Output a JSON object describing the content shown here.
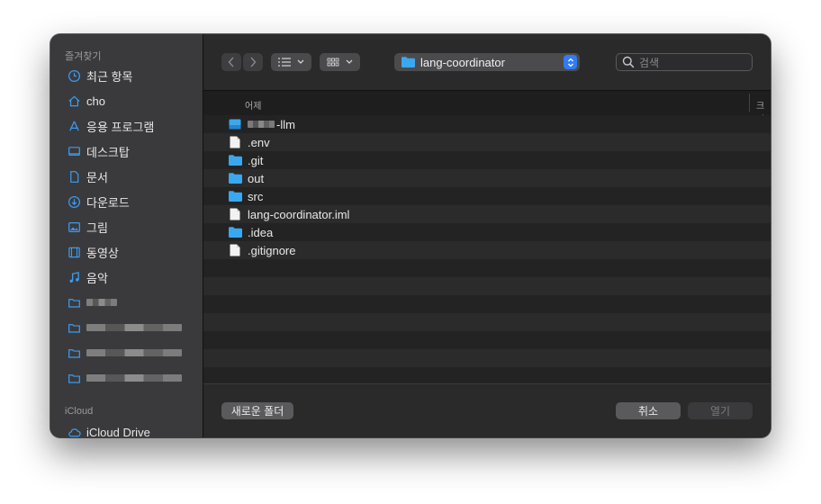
{
  "sidebar": {
    "favorites_title": "즐겨찾기",
    "items": [
      {
        "label": "최근 항목",
        "icon": "clock-icon"
      },
      {
        "label": "cho",
        "icon": "home-icon"
      },
      {
        "label": "응용 프로그램",
        "icon": "applications-icon"
      },
      {
        "label": "데스크탑",
        "icon": "desktop-icon"
      },
      {
        "label": "문서",
        "icon": "document-icon"
      },
      {
        "label": "다운로드",
        "icon": "download-icon"
      },
      {
        "label": "그림",
        "icon": "photo-icon"
      },
      {
        "label": "동영상",
        "icon": "film-icon"
      },
      {
        "label": "음악",
        "icon": "music-icon"
      }
    ],
    "redacted_folders": [
      "folder-1",
      "folder-2",
      "folder-3",
      "folder-4"
    ],
    "icloud_title": "iCloud",
    "icloud_drive": "iCloud Drive"
  },
  "toolbar": {
    "path_label": "lang-coordinator",
    "search_placeholder": "검색"
  },
  "columns": {
    "name": "어제",
    "size": "크기"
  },
  "files": [
    {
      "name": "-llm",
      "icon": "module-icon",
      "redacted_prefix": true
    },
    {
      "name": ".env",
      "icon": "file-icon"
    },
    {
      "name": ".git",
      "icon": "folder-icon"
    },
    {
      "name": "out",
      "icon": "folder-icon"
    },
    {
      "name": "src",
      "icon": "folder-icon"
    },
    {
      "name": "lang-coordinator.iml",
      "icon": "file-icon"
    },
    {
      "name": ".idea",
      "icon": "folder-icon"
    },
    {
      "name": ".gitignore",
      "icon": "file-icon"
    }
  ],
  "footer": {
    "new_folder": "새로운 폴더",
    "cancel": "취소",
    "open": "열기"
  },
  "colors": {
    "accent": "#2f7cf6",
    "folder": "#39a8f0"
  }
}
